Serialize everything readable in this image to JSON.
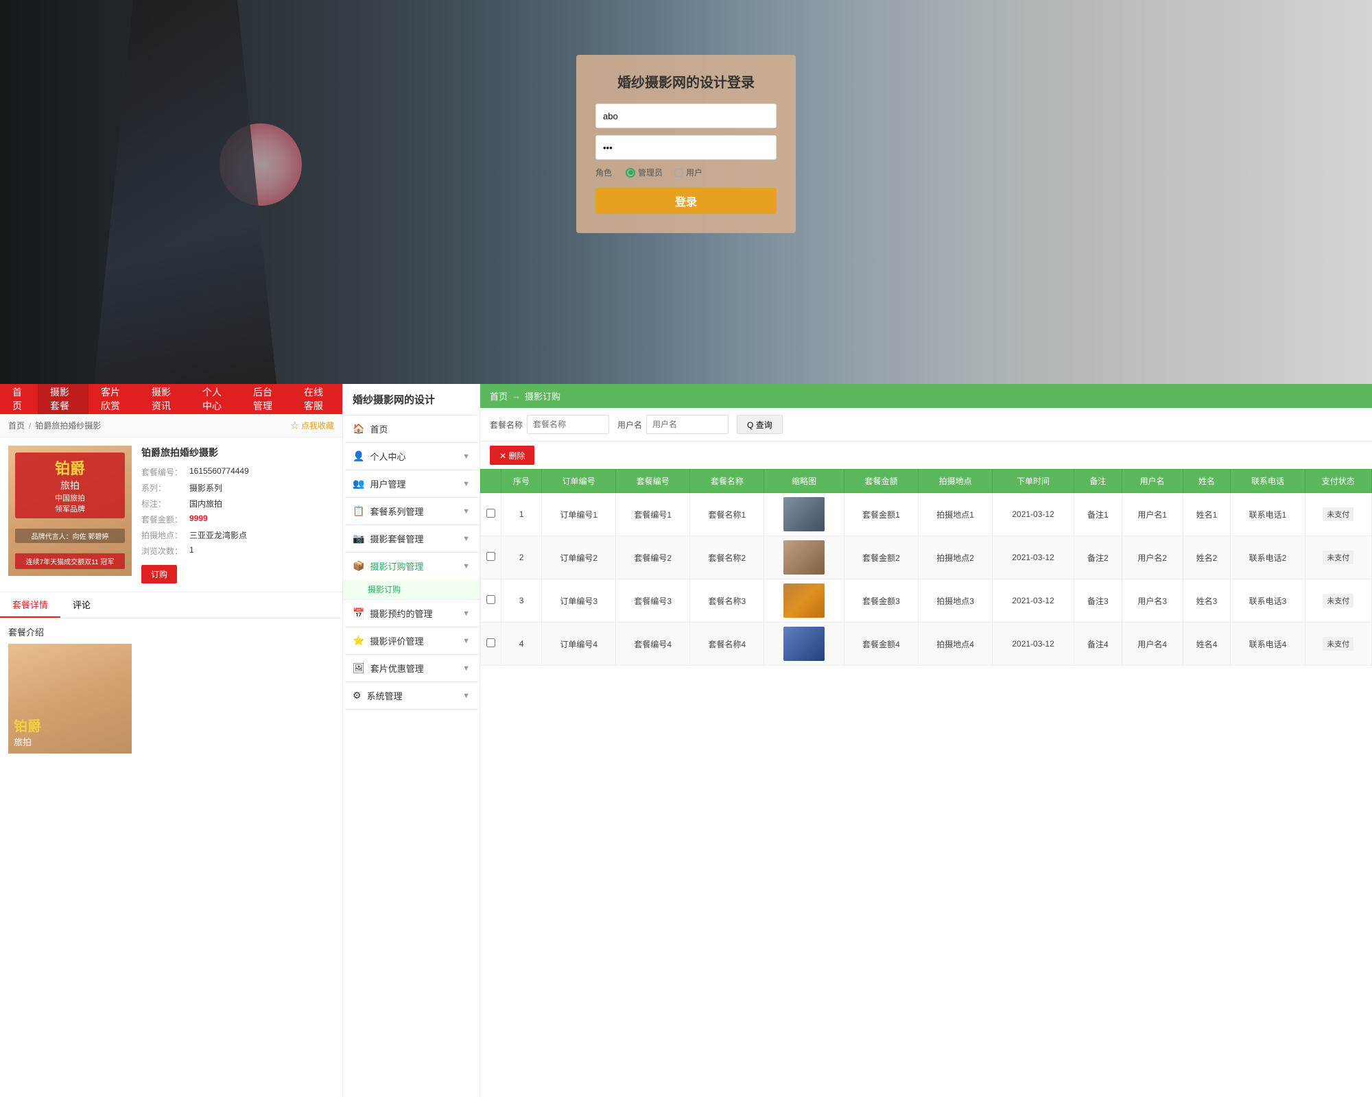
{
  "hero": {
    "login_title": "婚纱摄影网的设计登录",
    "username_placeholder": "abo",
    "password_value": "···",
    "role_label": "角色",
    "role_admin": "管理员",
    "role_user": "用户",
    "login_btn": "登录"
  },
  "nav": {
    "items": [
      {
        "label": "首页",
        "active": false
      },
      {
        "label": "摄影套餐",
        "active": true
      },
      {
        "label": "客片欣赏",
        "active": false
      },
      {
        "label": "摄影资讯",
        "active": false
      },
      {
        "label": "个人中心",
        "active": false
      },
      {
        "label": "后台管理",
        "active": false
      },
      {
        "label": "在线客服",
        "active": false
      }
    ]
  },
  "breadcrumb": {
    "home": "首页",
    "current": "铂爵旅拍婚纱摄影",
    "favorite": "☆ 点我收藏"
  },
  "package": {
    "name": "铂爵旅拍婚纱摄影",
    "number_label": "套餐编号：",
    "number_value": "1615560774449",
    "series_label": "系列：",
    "series_value": "摄影系列",
    "title_label": "标注：",
    "title_value": "国内旅拍",
    "price_label": "套餐金额：",
    "price_value": "9999",
    "location_label": "拍摄地点：",
    "location_value": "三亚亚龙湾影点",
    "views_label": "浏览次数：",
    "views_value": "1",
    "order_btn": "订购",
    "brand_big": "铂爵",
    "brand_line1": "旅拍",
    "brand_line2": "中国旅拍",
    "brand_line3": "领军品牌",
    "brand_promo": "品牌代言人：向佐 郭碧婷",
    "brand_award": "连续7年天猫成交额双11 冠军"
  },
  "tabs": {
    "detail": "套餐详情",
    "review": "评论",
    "intro_label": "套餐介绍"
  },
  "sidebar": {
    "site_title": "婚纱摄影网的设计",
    "menu": [
      {
        "label": "首页",
        "icon": "🏠",
        "active": false,
        "badge": ""
      },
      {
        "label": "个人中心",
        "icon": "👤",
        "active": false,
        "badge": "",
        "arrow": "▼"
      },
      {
        "label": "用户管理",
        "icon": "👥",
        "active": false,
        "badge": "",
        "arrow": "▼"
      },
      {
        "label": "套餐系列管理",
        "icon": "📋",
        "active": false,
        "badge": "",
        "arrow": "▼"
      },
      {
        "label": "摄影套餐管理",
        "icon": "📷",
        "active": false,
        "badge": "",
        "arrow": "▼"
      },
      {
        "label": "摄影订购管理",
        "icon": "📦",
        "active": true,
        "badge": "",
        "sub": "摄影订购"
      },
      {
        "label": "摄影预约的管理",
        "icon": "📅",
        "active": false,
        "badge": "",
        "arrow": "▼"
      },
      {
        "label": "摄影评价管理",
        "icon": "⭐",
        "active": false,
        "badge": "",
        "arrow": "▼"
      },
      {
        "label": "套片优惠管理",
        "icon": "🖼",
        "active": false,
        "badge": "",
        "arrow": "▼"
      },
      {
        "label": "系统管理",
        "icon": "⚙",
        "active": false,
        "badge": "",
        "arrow": "▼"
      }
    ]
  },
  "right_panel": {
    "breadcrumb": [
      "首页",
      "摄影订购"
    ],
    "search": {
      "package_name_label": "套餐名称",
      "package_name_placeholder": "套餐名称",
      "username_label": "用户名",
      "username_placeholder": "用户名",
      "search_btn": "Q 查询",
      "delete_btn": "✕ 删除"
    },
    "table": {
      "headers": [
        "",
        "序号",
        "订单编号",
        "套餐编号",
        "套餐名称",
        "缩略图",
        "套餐金额",
        "拍摄地点",
        "下单时间",
        "备注",
        "用户名",
        "姓名",
        "联系电话",
        "支付状态"
      ],
      "rows": [
        {
          "index": "1",
          "order_no": "订单编号1",
          "pkg_no": "套餐编号1",
          "pkg_name": "套餐名称1",
          "thumb_type": "arch",
          "amount": "套餐金额1",
          "location": "拍摄地点1",
          "date": "2021-03-12",
          "note": "备注1",
          "username": "用户名1",
          "name": "姓名1",
          "phone": "联系电话1",
          "status": "未支付"
        },
        {
          "index": "2",
          "order_no": "订单编号2",
          "pkg_no": "套餐编号2",
          "pkg_name": "套餐名称2",
          "thumb_type": "wedding",
          "amount": "套餐金额2",
          "location": "拍摄地点2",
          "date": "2021-03-12",
          "note": "备注2",
          "username": "用户名2",
          "name": "姓名2",
          "phone": "联系电话2",
          "status": "未支付"
        },
        {
          "index": "3",
          "order_no": "订单编号3",
          "pkg_no": "套餐编号3",
          "pkg_name": "套餐名称3",
          "thumb_type": "sunset",
          "amount": "套餐金额3",
          "location": "拍摄地点3",
          "date": "2021-03-12",
          "note": "备注3",
          "username": "用户名3",
          "name": "姓名3",
          "phone": "联系电话3",
          "status": "未支付"
        },
        {
          "index": "4",
          "order_no": "订单编号4",
          "pkg_no": "套餐编号4",
          "pkg_name": "套餐名称4",
          "thumb_type": "waterfall",
          "amount": "套餐金额4",
          "location": "拍摄地点4",
          "date": "2021-03-12",
          "note": "备注4",
          "username": "用户名4",
          "name": "姓名4",
          "phone": "联系电话4",
          "status": "未支付"
        }
      ]
    }
  }
}
